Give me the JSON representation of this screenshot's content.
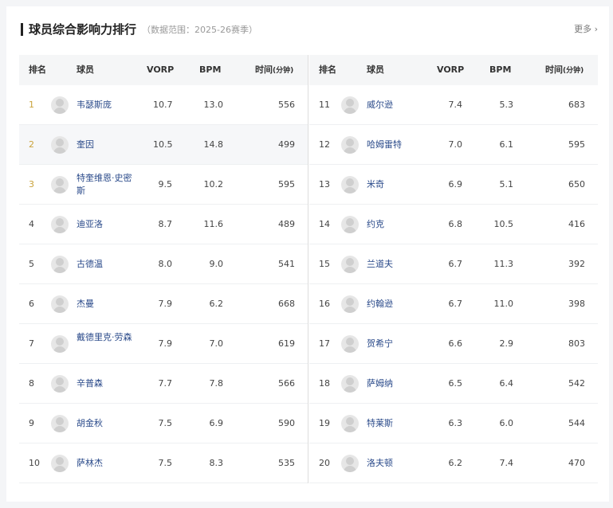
{
  "header": {
    "title": "球员综合影响力排行",
    "subtitle": "（数据范围：2025-26赛季）",
    "more": "更多 ›"
  },
  "columns": {
    "rank": "排名",
    "player": "球员",
    "vorp": "VORP",
    "bpm": "BPM",
    "time": "时间",
    "time_unit": "(分钟)"
  },
  "left_rows": [
    {
      "rank": "1",
      "name": "韦瑟斯庞",
      "vorp": "10.7",
      "bpm": "13.0",
      "time": "556"
    },
    {
      "rank": "2",
      "name": "奎因",
      "vorp": "10.5",
      "bpm": "14.8",
      "time": "499"
    },
    {
      "rank": "3",
      "name": "特奎维恩·史密斯",
      "vorp": "9.5",
      "bpm": "10.2",
      "time": "595"
    },
    {
      "rank": "4",
      "name": "迪亚洛",
      "vorp": "8.7",
      "bpm": "11.6",
      "time": "489"
    },
    {
      "rank": "5",
      "name": "古德温",
      "vorp": "8.0",
      "bpm": "9.0",
      "time": "541"
    },
    {
      "rank": "6",
      "name": "杰曼",
      "vorp": "7.9",
      "bpm": "6.2",
      "time": "668"
    },
    {
      "rank": "7",
      "name": "戴德里克·劳森",
      "vorp": "7.9",
      "bpm": "7.0",
      "time": "619"
    },
    {
      "rank": "8",
      "name": "辛普森",
      "vorp": "7.7",
      "bpm": "7.8",
      "time": "566"
    },
    {
      "rank": "9",
      "name": "胡金秋",
      "vorp": "7.5",
      "bpm": "6.9",
      "time": "590"
    },
    {
      "rank": "10",
      "name": "萨林杰",
      "vorp": "7.5",
      "bpm": "8.3",
      "time": "535"
    }
  ],
  "right_rows": [
    {
      "rank": "11",
      "name": "威尔逊",
      "vorp": "7.4",
      "bpm": "5.3",
      "time": "683"
    },
    {
      "rank": "12",
      "name": "哈姆雷特",
      "vorp": "7.0",
      "bpm": "6.1",
      "time": "595"
    },
    {
      "rank": "13",
      "name": "米奇",
      "vorp": "6.9",
      "bpm": "5.1",
      "time": "650"
    },
    {
      "rank": "14",
      "name": "约克",
      "vorp": "6.8",
      "bpm": "10.5",
      "time": "416"
    },
    {
      "rank": "15",
      "name": "兰道夫",
      "vorp": "6.7",
      "bpm": "11.3",
      "time": "392"
    },
    {
      "rank": "16",
      "name": "约翰逊",
      "vorp": "6.7",
      "bpm": "11.0",
      "time": "398"
    },
    {
      "rank": "17",
      "name": "贺希宁",
      "vorp": "6.6",
      "bpm": "2.9",
      "time": "803"
    },
    {
      "rank": "18",
      "name": "萨姆纳",
      "vorp": "6.5",
      "bpm": "6.4",
      "time": "542"
    },
    {
      "rank": "19",
      "name": "特莱斯",
      "vorp": "6.3",
      "bpm": "6.0",
      "time": "544"
    },
    {
      "rank": "20",
      "name": "洛夫顿",
      "vorp": "6.2",
      "bpm": "7.4",
      "time": "470"
    }
  ],
  "colors": {
    "accent_rank": "#c9a23b",
    "player_link": "#2a4a8a"
  }
}
